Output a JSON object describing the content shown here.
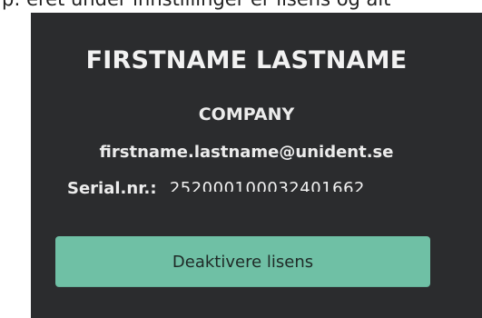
{
  "top_text": "ρ: eret under innstillinger er lisens og alt",
  "license": {
    "name": "FIRSTNAME LASTNAME",
    "company": "COMPANY",
    "email": "firstname.lastname@unident.se",
    "serial_label": "Serial.nr.:",
    "serial_value": "252000100032401662"
  },
  "deactivate_label": "Deaktivere lisens",
  "colors": {
    "panel_background": "#2b2c2e",
    "button_accent": "#6fc0a5",
    "text": "#ececec"
  }
}
